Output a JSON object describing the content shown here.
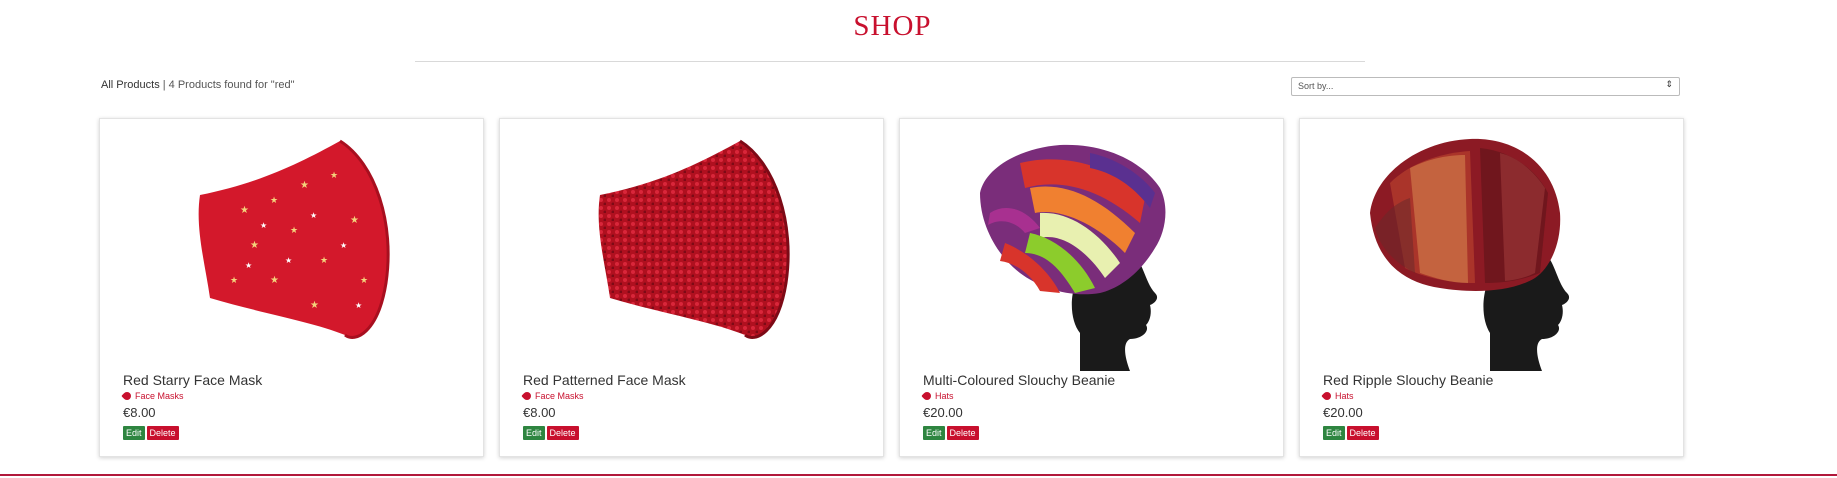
{
  "page": {
    "title": "SHOP"
  },
  "breadcrumb": {
    "all_products": "All Products",
    "result_text": " | 4 Products found for \"red\""
  },
  "sort": {
    "label": "Sort by...",
    "caret": "⇕"
  },
  "products": [
    {
      "name": "Red Starry Face Mask",
      "category": "Face Masks",
      "price": "€8.00",
      "image": "red-starry-face-mask-image"
    },
    {
      "name": "Red Patterned Face Mask",
      "category": "Face Masks",
      "price": "€8.00",
      "image": "red-patterned-face-mask-image"
    },
    {
      "name": "Multi-Coloured Slouchy Beanie",
      "category": "Hats",
      "price": "€20.00",
      "image": "multi-coloured-beanie-image"
    },
    {
      "name": "Red Ripple Slouchy Beanie",
      "category": "Hats",
      "price": "€20.00",
      "image": "red-ripple-beanie-image"
    }
  ],
  "actions": {
    "edit": "Edit",
    "delete": "Delete"
  },
  "colors": {
    "brand": "#c8102e",
    "edit_button": "#2e8540",
    "delete_button": "#c8102e"
  }
}
